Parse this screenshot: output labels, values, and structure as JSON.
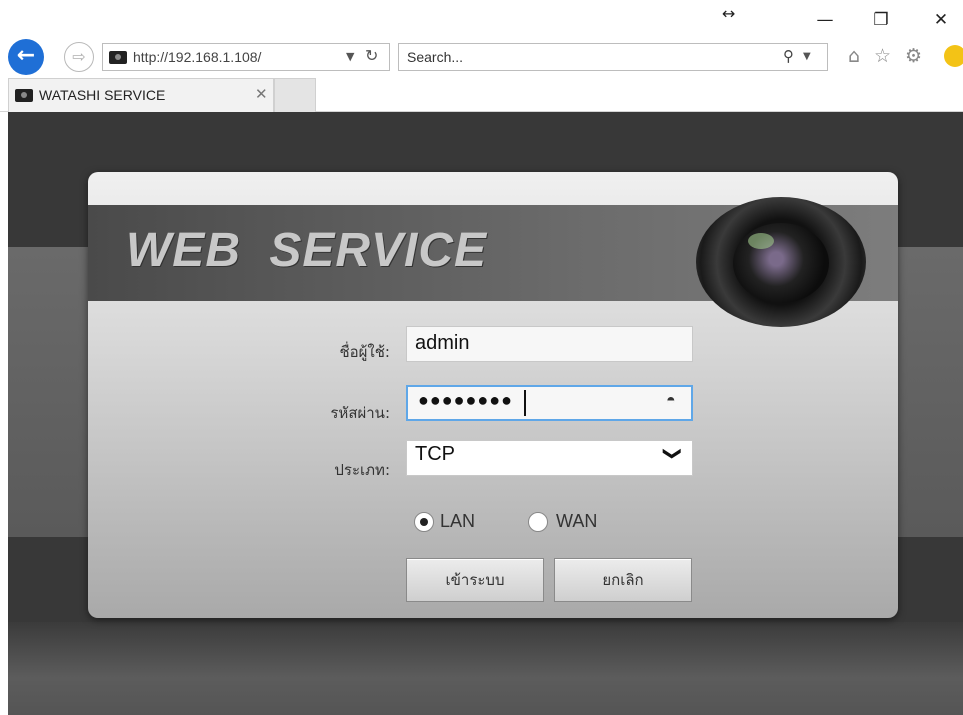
{
  "browser": {
    "url": "http://192.168.1.108/",
    "search_placeholder": "Search...",
    "tab_title": "WATASHI SERVICE",
    "icons": [
      "back-arrow-icon",
      "forward-arrow-icon",
      "refresh-icon",
      "search-icon",
      "home-icon",
      "star-icon",
      "gear-icon",
      "smiley-icon"
    ]
  },
  "login": {
    "banner_title": "WEB  SERVICE",
    "username_label": "ชื่อผู้ใช้:",
    "username_value": "admin",
    "password_label": "รหัสผ่าน:",
    "password_mask": "●●●●●●●●",
    "type_label": "ประเภท:",
    "type_value": "TCP",
    "radio_lan": "LAN",
    "radio_wan": "WAN",
    "selected_network": "LAN",
    "login_button": "เข้าระบบ",
    "cancel_button": "ยกเลิก"
  },
  "colors": {
    "page_background": "#383838",
    "focus_border": "#5fa7e8",
    "back_button": "#1f6fd6"
  }
}
